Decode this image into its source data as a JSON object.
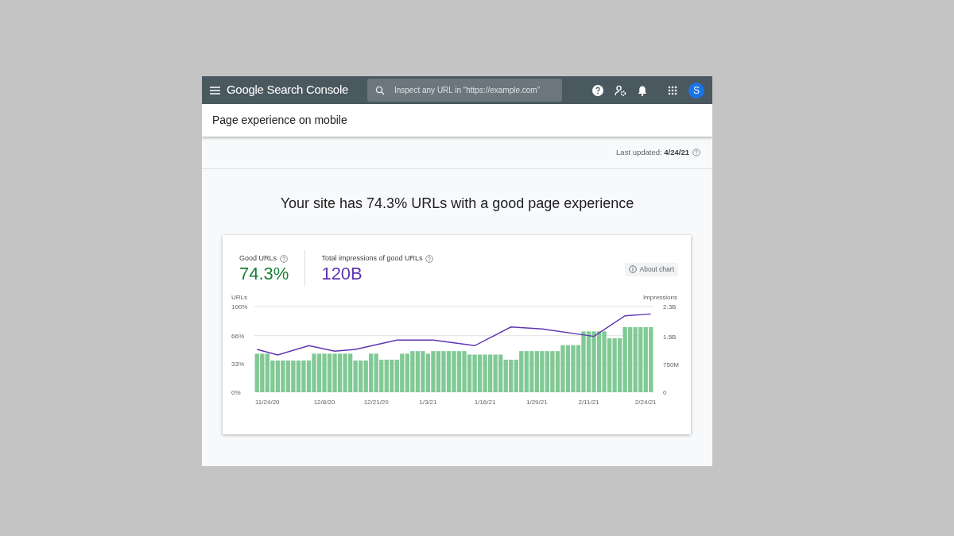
{
  "header": {
    "logo_text": "Google Search Console",
    "search": {
      "placeholder": "Inspect any URL in “https://example.com”"
    },
    "avatar_letter": "S"
  },
  "page_title": "Page experience on mobile",
  "last_updated": {
    "label": "Last updated:",
    "value": "4/24/21"
  },
  "headline": "Your site has 74.3% URLs with a good page experience",
  "metrics": [
    {
      "label": "Good URLs",
      "value": "74.3%",
      "color": "#188038"
    },
    {
      "label": "Total impressions of good URLs",
      "value": "120B",
      "color": "#5e35b1"
    }
  ],
  "about_chart": "About chart",
  "chart_data": {
    "type": "bar",
    "ylabel": "URLs",
    "y2label": "Impressions",
    "categories": [
      null,
      null,
      "11/24/20",
      null,
      null,
      null,
      null,
      null,
      null,
      null,
      null,
      null,
      null,
      "12/8/20",
      null,
      null,
      null,
      null,
      null,
      null,
      null,
      null,
      null,
      "12/21/20",
      null,
      null,
      null,
      null,
      null,
      null,
      null,
      null,
      null,
      "1/3/21",
      null,
      null,
      null,
      null,
      null,
      null,
      null,
      null,
      null,
      null,
      "1/16/21",
      null,
      null,
      null,
      null,
      null,
      null,
      null,
      null,
      null,
      "1/29/21",
      null,
      null,
      null,
      null,
      null,
      null,
      null,
      null,
      null,
      "2/11/21",
      null,
      null,
      null,
      null,
      null,
      null,
      null,
      null,
      null,
      null,
      "2/24/21",
      null
    ],
    "ylim": [
      0,
      100
    ],
    "y2lim": [
      0,
      2300000000
    ],
    "yticks": [
      {
        "value": 0,
        "label": "0%"
      },
      {
        "value": 33,
        "label": "33%"
      },
      {
        "value": 66,
        "label": "66%"
      },
      {
        "value": 100,
        "label": "100%"
      }
    ],
    "y2ticks": [
      {
        "value": 0,
        "label": "0"
      },
      {
        "value": 750000000,
        "label": "750M"
      },
      {
        "value": 1500000000,
        "label": "1.5B"
      },
      {
        "value": 2300000000,
        "label": "2.3B"
      }
    ],
    "series": [
      {
        "color": "#81c995",
        "values": [
          45,
          45,
          45,
          37,
          37,
          37,
          37,
          37,
          37,
          37,
          37,
          45,
          45,
          45,
          45,
          45,
          45,
          45,
          45,
          37,
          37,
          37,
          45,
          45,
          38,
          38,
          38,
          38,
          45,
          45,
          48,
          48,
          48,
          45,
          48,
          48,
          48,
          48,
          48,
          48,
          48,
          44,
          44,
          44,
          44,
          44,
          44,
          44,
          38,
          38,
          38,
          48,
          48,
          48,
          48,
          48,
          48,
          48,
          48,
          55,
          55,
          55,
          55,
          71,
          71,
          71,
          71,
          71,
          63,
          63,
          63,
          76,
          76,
          76,
          76,
          76,
          76
        ]
      },
      {
        "type": "line",
        "axis": "y2",
        "color": "#5e35b1",
        "values": [
          1150000000,
          null,
          null,
          null,
          1000000000,
          null,
          null,
          null,
          null,
          null,
          1250000000,
          null,
          null,
          null,
          null,
          1100000000,
          null,
          null,
          null,
          1150000000,
          null,
          null,
          null,
          null,
          null,
          null,
          null,
          1400000000,
          null,
          null,
          null,
          null,
          null,
          null,
          1400000000,
          null,
          null,
          null,
          null,
          null,
          null,
          null,
          1250000000,
          null,
          null,
          null,
          null,
          null,
          null,
          1750000000,
          null,
          null,
          null,
          null,
          null,
          1700000000,
          null,
          null,
          null,
          null,
          null,
          null,
          null,
          null,
          null,
          1500000000,
          null,
          null,
          null,
          null,
          null,
          2050000000,
          null,
          null,
          null,
          null,
          2100000000
        ]
      }
    ]
  }
}
